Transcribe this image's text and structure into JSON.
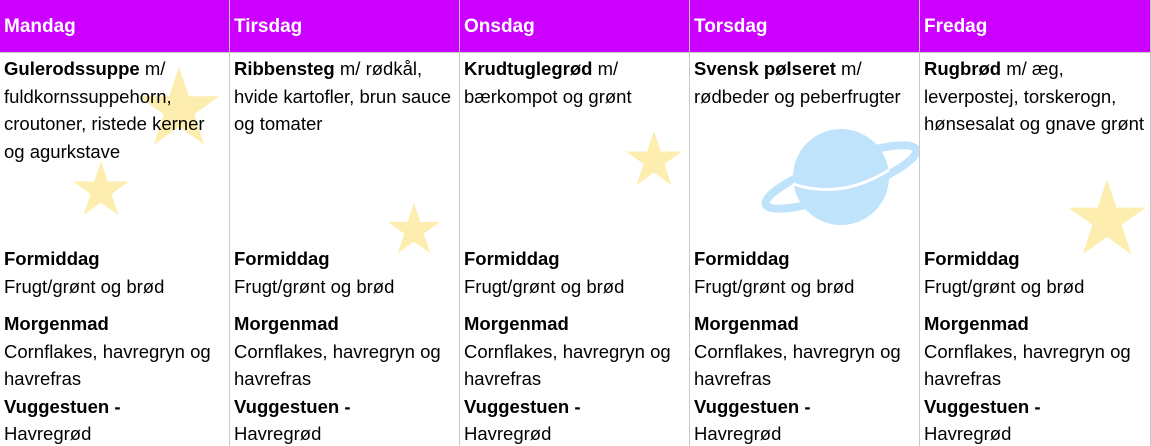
{
  "days": [
    {
      "name": "Mandag",
      "lunch_title": "Gulerodssuppe",
      "lunch_rest": " m/ fuldkornssuppehorn, croutoner, ristede kerner og agurkstave",
      "formiddag_title": "Formiddag",
      "formiddag_text": "Frugt/grønt og brød",
      "morgen_title": "Morgenmad",
      "morgen_text": "Cornflakes, havregryn og havrefras",
      "vugge_title": "Vuggestuen -",
      "vugge_text": "Havregrød"
    },
    {
      "name": "Tirsdag",
      "lunch_title": "Ribbensteg",
      "lunch_rest": " m/ rødkål, hvide kartofler, brun sauce og tomater",
      "formiddag_title": "Formiddag",
      "formiddag_text": "Frugt/grønt og brød",
      "morgen_title": "Morgenmad",
      "morgen_text": "Cornflakes, havregryn og havrefras",
      "vugge_title": "Vuggestuen -",
      "vugge_text": "Havregrød"
    },
    {
      "name": "Onsdag",
      "lunch_title": "Krudtuglegrød",
      "lunch_rest": " m/ bærkompot og grønt",
      "formiddag_title": "Formiddag",
      "formiddag_text": "Frugt/grønt og brød",
      "morgen_title": "Morgenmad",
      "morgen_text": "Cornflakes, havregryn og havrefras",
      "vugge_title": "Vuggestuen -",
      "vugge_text": "Havregrød"
    },
    {
      "name": "Torsdag",
      "lunch_title": "Svensk pølseret",
      "lunch_rest": " m/ rødbeder og peberfrugter",
      "formiddag_title": "Formiddag",
      "formiddag_text": "Frugt/grønt og brød",
      "morgen_title": "Morgenmad",
      "morgen_text": "Cornflakes, havregryn og havrefras",
      "vugge_title": "Vuggestuen -",
      "vugge_text": "Havregrød"
    },
    {
      "name": "Fredag",
      "lunch_title": "Rugbrød",
      "lunch_rest": " m/ æg, leverpostej, torskerogn, hønsesalat og gnave grønt",
      "formiddag_title": "Formiddag",
      "formiddag_text": "Frugt/grønt og brød",
      "morgen_title": "Morgenmad",
      "morgen_text": "Cornflakes, havregryn og havrefras",
      "vugge_title": "Vuggestuen -",
      "vugge_text": "Havregrød"
    }
  ],
  "decorations": [
    "star-icon",
    "planet-icon"
  ],
  "colors": {
    "header": "#cc00ff",
    "star": "#fdeeb0",
    "planet": "#bfe3fb"
  }
}
